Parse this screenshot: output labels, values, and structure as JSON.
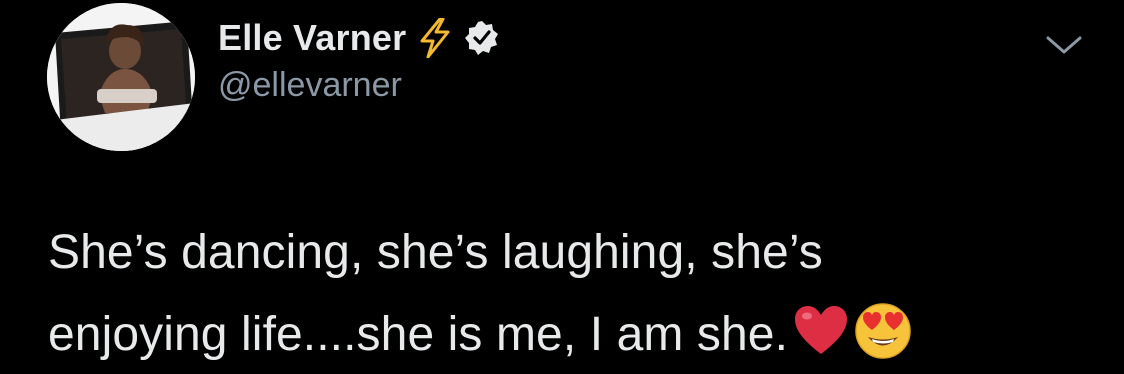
{
  "author": {
    "display_name": "Elle Varner",
    "handle": "@ellevarner",
    "name_emoji": "lightning-bolt-icon",
    "verified_icon": "verified-badge-icon"
  },
  "menu": {
    "icon": "chevron-down-icon"
  },
  "tweet": {
    "line1": "She’s dancing, she’s laughing, she’s",
    "line2": "enjoying life....she is me, I am she.",
    "emojis": [
      "red-heart-icon",
      "heart-eyes-face-icon"
    ]
  },
  "colors": {
    "background": "#000000",
    "text": "#e7e9ea",
    "secondary_text": "#8b98a5",
    "bolt": "#f5b82e",
    "heart": "#dd2e44"
  }
}
